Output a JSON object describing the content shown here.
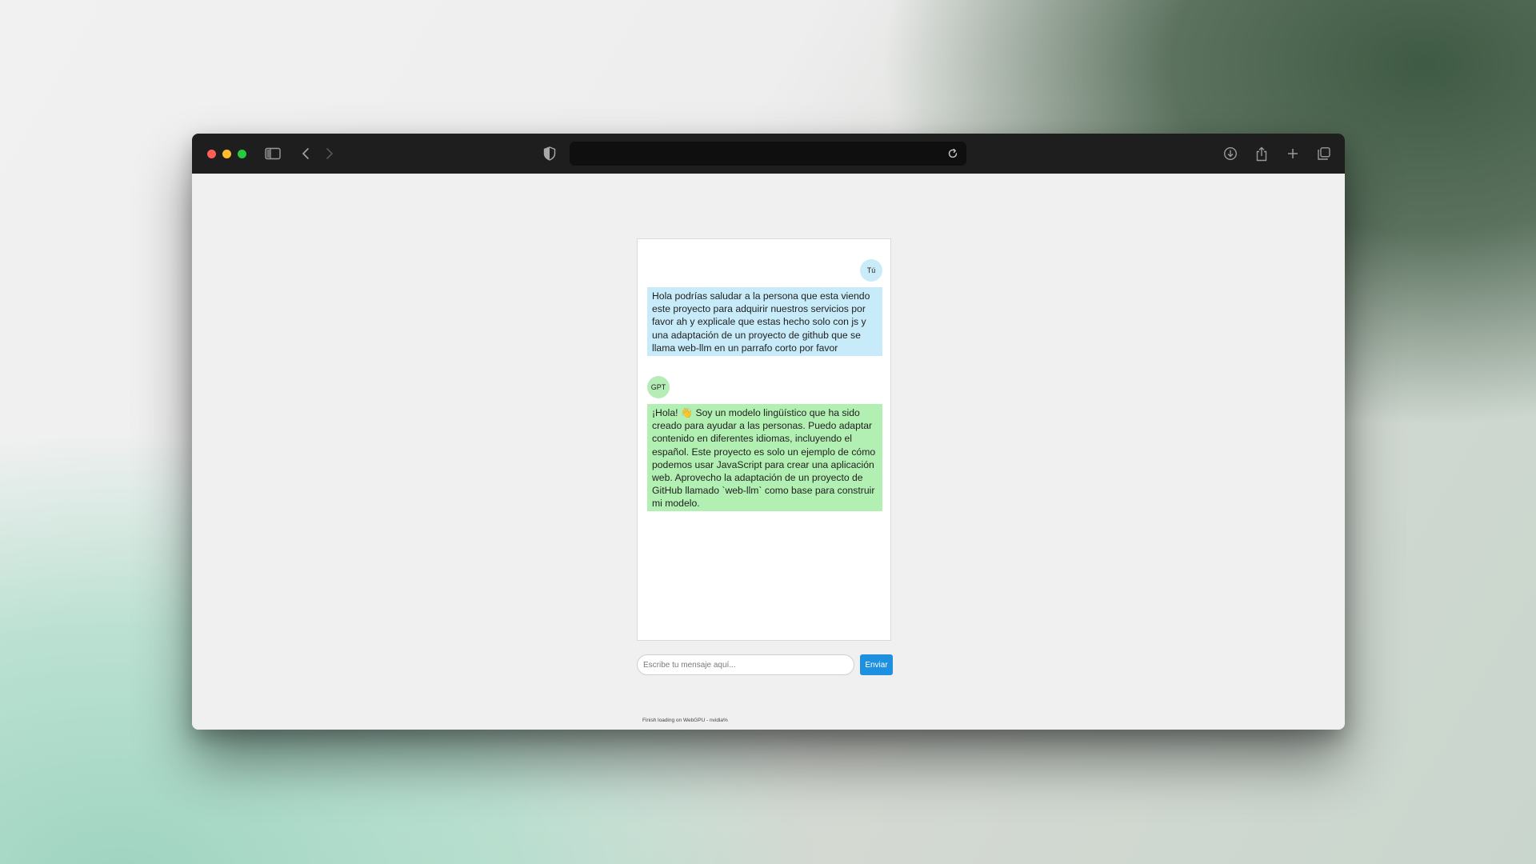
{
  "browser": {
    "url": "",
    "icons": [
      "sidebar-icon",
      "back-icon",
      "forward-icon",
      "shield-icon",
      "reload-icon",
      "download-icon",
      "share-icon",
      "new-tab-icon",
      "tab-overview-icon"
    ]
  },
  "chat": {
    "user_label": "Tú",
    "user_message": "Hola podrías saludar a la persona que esta viendo\neste proyecto para adquirir nuestros servicios por\nfavor ah y explicale que estas hecho solo con js y\nuna adaptación de un proyecto de github que se\nllama web-llm en un parrafo corto por favor",
    "bot_label": "GPT",
    "bot_message": "¡Hola! 👋 Soy un modelo lingüístico que ha sido\ncreado para ayudar a las personas. Puedo adaptar\ncontenido en diferentes idiomas, incluyendo el\nespañol. Este proyecto es solo un ejemplo de cómo\npodemos usar JavaScript para crear una aplicación\nweb. Aprovecho la adaptación de un proyecto de\nGitHub llamado `web-llm` como base para construir\nmi modelo."
  },
  "composer": {
    "placeholder": "Escribe tu mensaje aquí...",
    "value": "",
    "send_label": "Enviar"
  },
  "status": {
    "text": "Finish loading on WebGPU - nvidia%"
  },
  "colors": {
    "user_bubble": "#c7ebf8",
    "bot_bubble": "#b2efb2",
    "send_button": "#1e90e0",
    "toolbar": "#1e1e1e"
  }
}
